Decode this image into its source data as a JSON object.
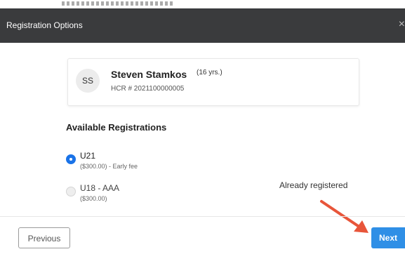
{
  "modal": {
    "title": "Registration Options",
    "close_symbol": "×"
  },
  "player": {
    "initials": "SS",
    "name": "Steven Stamkos",
    "age": "(16 yrs.)",
    "hcr": "HCR # 2021100000005"
  },
  "registrations": {
    "heading": "Available Registrations",
    "options": [
      {
        "label": "U21",
        "fee": "($300.00) - Early fee",
        "selected": true,
        "disabled": false
      },
      {
        "label": "U18 - AAA",
        "fee": "($300.00)",
        "selected": false,
        "disabled": true
      }
    ]
  },
  "annotation": {
    "text": "Already registered",
    "arrow_color": "#e8553a"
  },
  "footer": {
    "previous_label": "Previous",
    "next_label": "Next"
  },
  "colors": {
    "accent": "#2f8fe6",
    "header_bg": "#3a3b3d"
  },
  "icons": {
    "close": "close-icon",
    "arrow": "red-arrow-icon"
  }
}
